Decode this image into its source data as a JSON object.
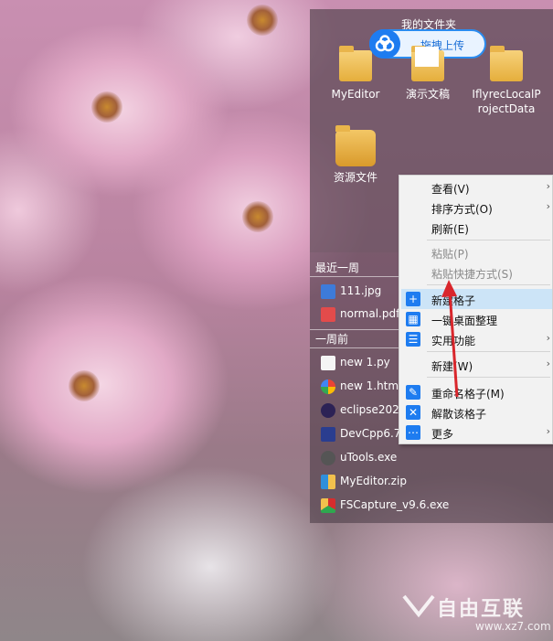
{
  "panel": {
    "folder_title": "我的文件夹",
    "upload_label": "拖拽上传",
    "desktop_items": [
      {
        "label": "MyEditor",
        "icon": "folder-icon"
      },
      {
        "label": "演示文稿",
        "icon": "document-folder-icon"
      },
      {
        "label": "IflyrecLocalProjectData",
        "line1": "IflyrecLocalP",
        "line2": "rojectData",
        "icon": "folder-icon"
      },
      {
        "label": "资源文件",
        "icon": "resource-folder-icon"
      }
    ],
    "recent_week_label": "最近一周",
    "recent_files": [
      {
        "name": "111.jpg",
        "icon": "jpg-file-icon"
      },
      {
        "name": "normal.pdf",
        "icon": "pdf-file-icon"
      }
    ],
    "week_ago_label": "一周前",
    "older_files": [
      {
        "name": "new 1.py",
        "icon": "blank-file-icon"
      },
      {
        "name": "new 1.html",
        "icon": "html-file-icon"
      },
      {
        "name": "eclipse2022",
        "icon": "eclipse-icon"
      },
      {
        "name": "DevCpp6.7",
        "icon": "devcpp-icon"
      },
      {
        "name": "uTools.exe",
        "icon": "utools-icon"
      },
      {
        "name": "MyEditor.zip",
        "icon": "zip-file-icon"
      },
      {
        "name": "FSCapture_v9.6.exe",
        "icon": "fscapture-icon"
      }
    ]
  },
  "context_menu": {
    "items": [
      {
        "label": "查看(V)",
        "has_submenu": true
      },
      {
        "label": "排序方式(O)",
        "has_submenu": true
      },
      {
        "label": "刷新(E)",
        "has_submenu": false
      },
      {
        "label": "粘贴(P)",
        "disabled": true
      },
      {
        "label": "粘贴快捷方式(S)",
        "disabled": true
      },
      {
        "label": "新建格子",
        "icon": "plus-icon",
        "highlighted": true
      },
      {
        "label": "一键桌面整理",
        "icon": "grid-icon"
      },
      {
        "label": "实用功能",
        "icon": "list-icon",
        "has_submenu": true
      },
      {
        "label": "新建(W)",
        "has_submenu": true
      },
      {
        "label": "重命名格子(M)",
        "icon": "rename-icon"
      },
      {
        "label": "解散该格子",
        "icon": "dissolve-icon"
      },
      {
        "label": "更多",
        "icon": "more-icon",
        "has_submenu": true
      }
    ]
  },
  "watermark": {
    "brand": "自由互联",
    "url": "www.xz7.com"
  },
  "colors": {
    "accent": "#1e7cf0",
    "highlight": "#cce4f7",
    "arrow": "#d9262c"
  }
}
